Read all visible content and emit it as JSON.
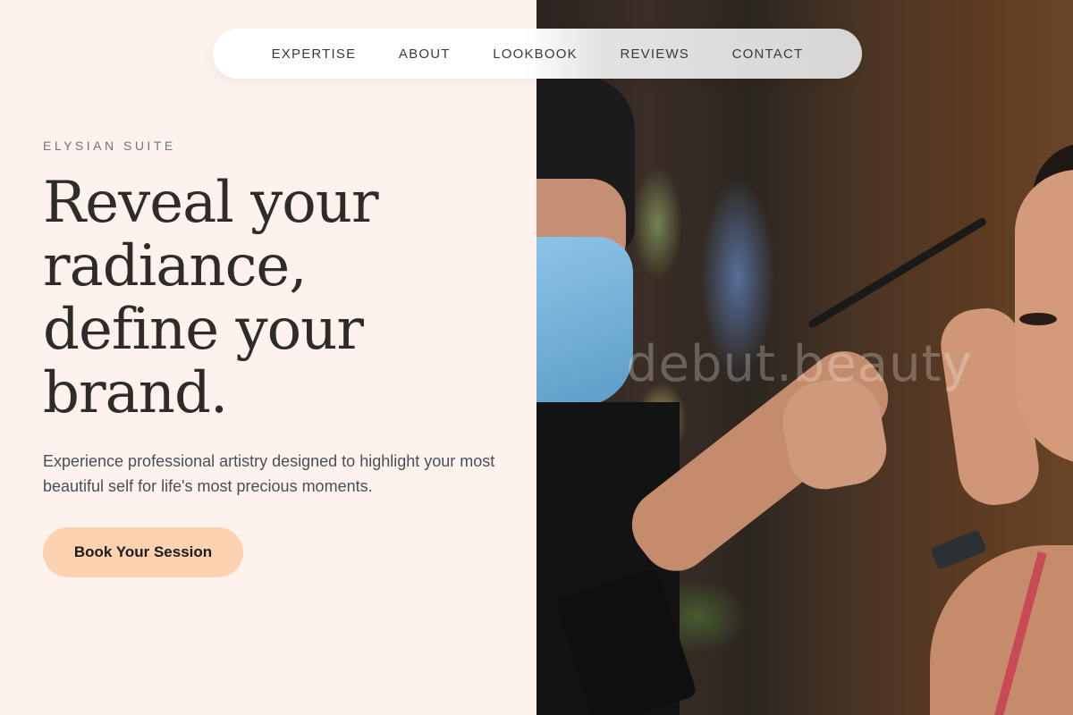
{
  "nav": {
    "items": [
      {
        "label": "EXPERTISE"
      },
      {
        "label": "ABOUT"
      },
      {
        "label": "LOOKBOOK"
      },
      {
        "label": "REVIEWS"
      },
      {
        "label": "CONTACT"
      }
    ]
  },
  "hero": {
    "eyebrow": "ELYSIAN SUITE",
    "headline_lines": [
      "Reveal your",
      "radiance,",
      "define your",
      "brand."
    ],
    "subcopy": "Experience professional artistry designed to highlight your most beautiful self for life's most precious moments.",
    "cta_label": "Book Your Session"
  },
  "image": {
    "watermark": "debut.beauty"
  },
  "colors": {
    "background": "#fdf3ec",
    "cta": "#fdd2b0",
    "headline": "#2e2c2a"
  }
}
